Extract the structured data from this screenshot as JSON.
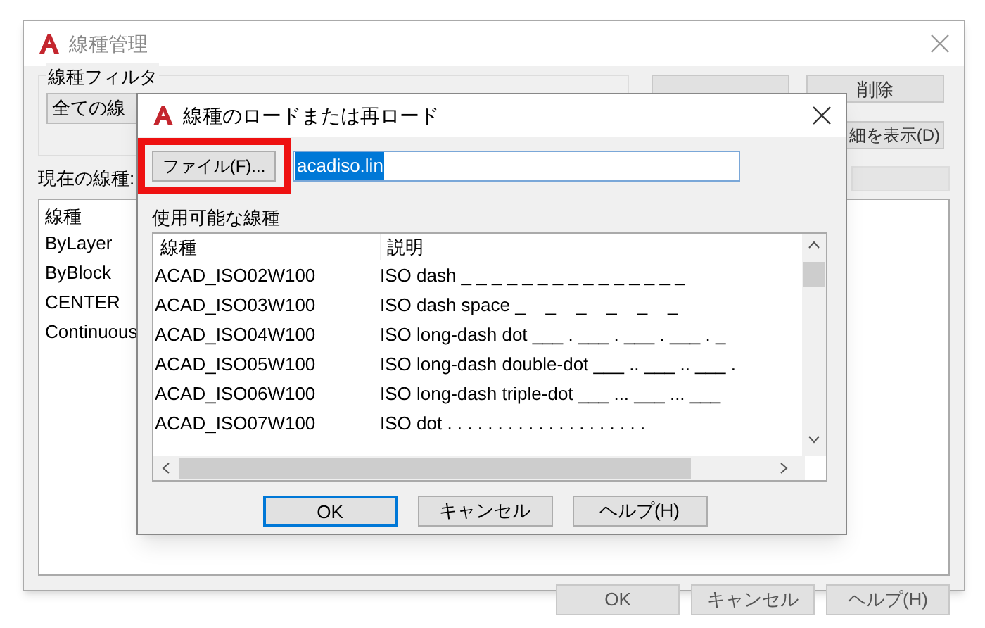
{
  "main_window": {
    "title": "線種管理",
    "filter_label": "線種フィルタ",
    "filter_value": "全ての線",
    "delete_button": "削除",
    "details_button": "細を表示(D)",
    "current_label": "現在の線種:",
    "list": {
      "column_1": "線種",
      "rows": [
        "ByLayer",
        "ByBlock",
        "CENTER",
        "Continuous"
      ]
    },
    "buttons": [
      "OK",
      "キャンセル",
      "ヘルプ(H)"
    ]
  },
  "dialog": {
    "title": "線種のロードまたは再ロード",
    "file_button": "ファイル(F)...",
    "file_button_highlighted": true,
    "file_field": {
      "value": "acadiso.lin",
      "selected": true
    },
    "list_label": "使用可能な線種",
    "columns": [
      "線種",
      "説明"
    ],
    "rows": [
      {
        "linetype": "ACAD_ISO02W100",
        "description": "ISO dash _ _ _ _ _ _ _ _ _ _ _ _ _ _ _"
      },
      {
        "linetype": "ACAD_ISO03W100",
        "description": "ISO dash space _    _    _    _    _    _"
      },
      {
        "linetype": "ACAD_ISO04W100",
        "description": "ISO long-dash dot ___ . ___ . ___ . ___ . _"
      },
      {
        "linetype": "ACAD_ISO05W100",
        "description": "ISO long-dash double-dot ___ .. ___ .. ___ ."
      },
      {
        "linetype": "ACAD_ISO06W100",
        "description": "ISO long-dash triple-dot ___ ... ___ ... ___"
      },
      {
        "linetype": "ACAD_ISO07W100",
        "description": "ISO dot . . . . . . . . . . . . . . . . . . . ."
      }
    ],
    "buttons": [
      {
        "label": "OK",
        "focused": true
      },
      {
        "label": "キャンセル",
        "focused": false
      },
      {
        "label": "ヘルプ(H)",
        "focused": false
      }
    ]
  }
}
